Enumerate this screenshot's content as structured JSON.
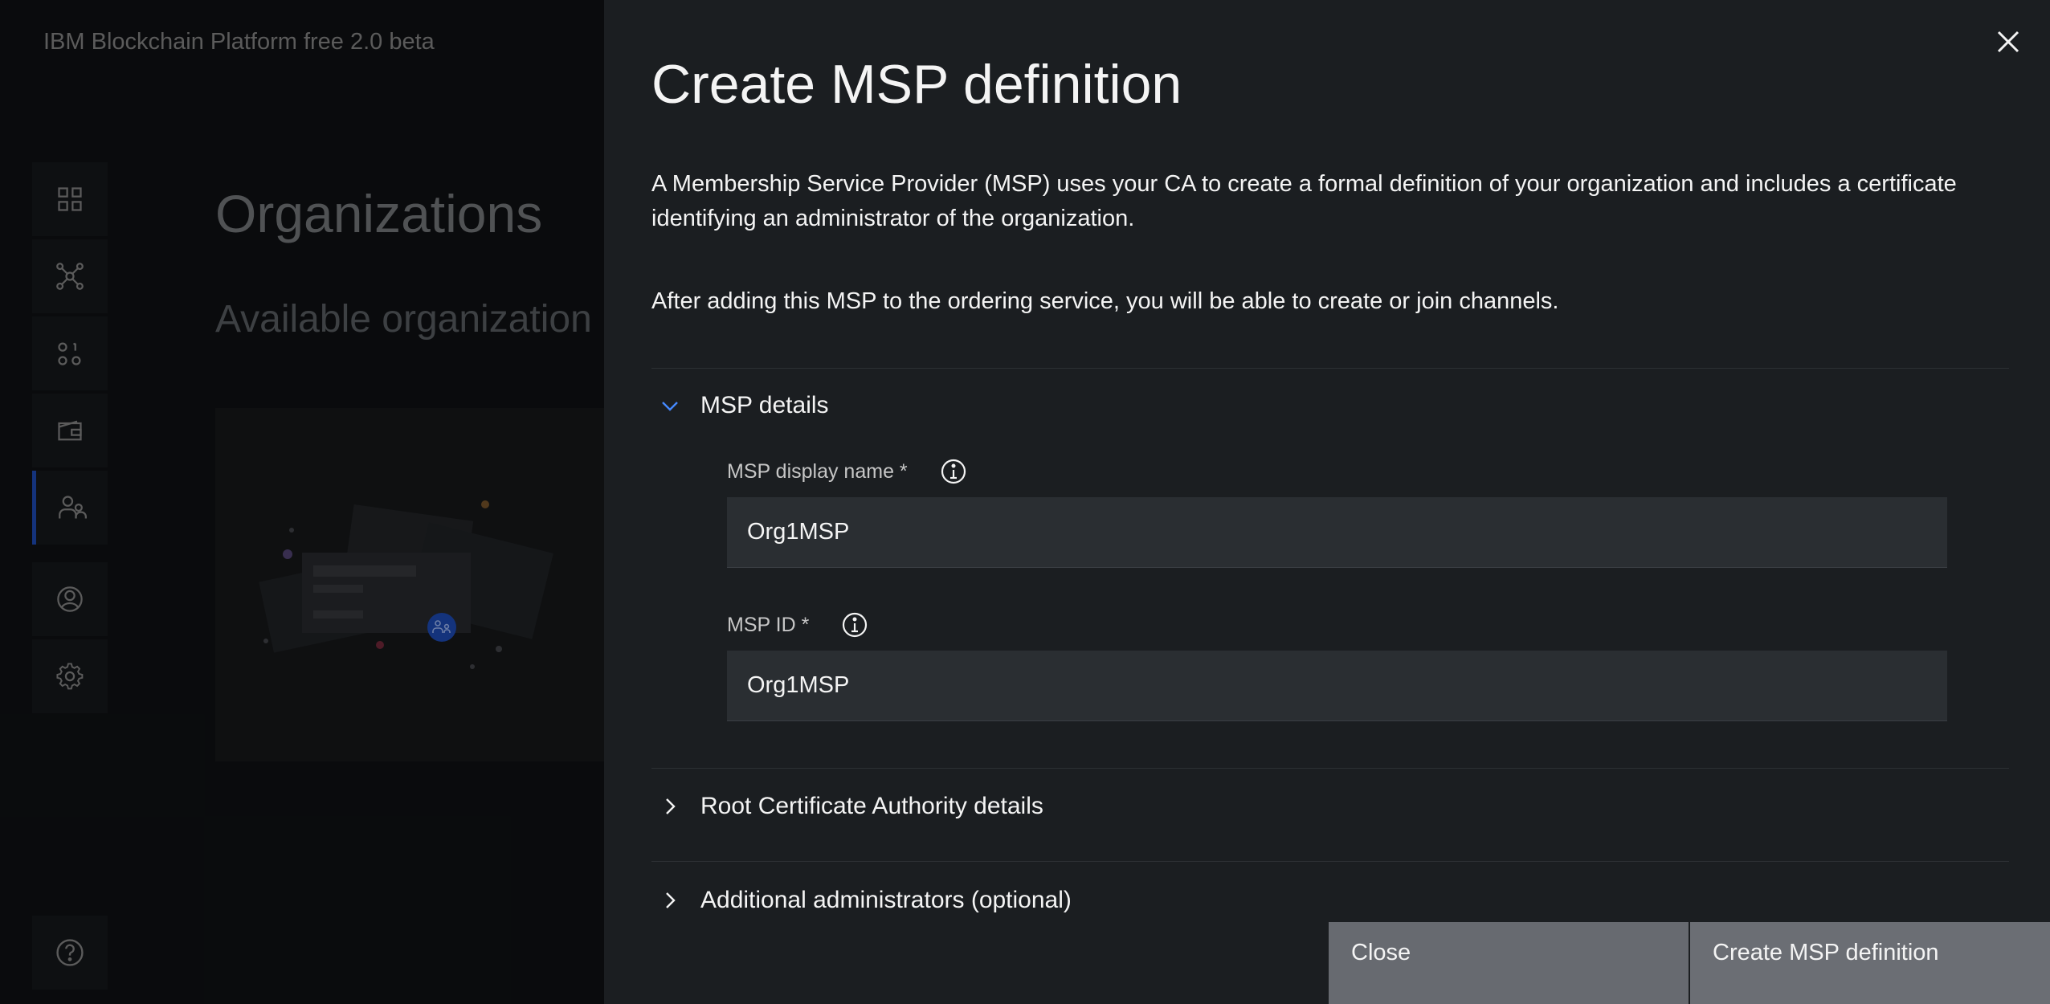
{
  "app": {
    "title": "IBM Blockchain Platform free 2.0 beta"
  },
  "sidebar": {
    "items": [
      {
        "icon": "dashboard-grid-icon"
      },
      {
        "icon": "network-nodes-icon"
      },
      {
        "icon": "binary-identities-icon"
      },
      {
        "icon": "wallet-icon"
      },
      {
        "icon": "organizations-icon",
        "active": true
      },
      {
        "icon": "user-profile-icon"
      },
      {
        "icon": "settings-gear-icon"
      }
    ],
    "help_icon": "help-icon"
  },
  "background_page": {
    "title": "Organizations",
    "subtitle": "Available organization"
  },
  "panel": {
    "title": "Create MSP definition",
    "description_1": "A Membership Service Provider (MSP) uses your CA to create a formal definition of your organization and includes a certificate identifying an administrator of the organization.",
    "description_2": "After adding this MSP to the ordering service, you will be able to create or join channels.",
    "sections": {
      "msp_details": {
        "label": "MSP details",
        "expanded": true,
        "display_name_label": "MSP display name *",
        "display_name_value": "Org1MSP",
        "msp_id_label": "MSP ID *",
        "msp_id_value": "Org1MSP"
      },
      "root_ca": {
        "label": "Root Certificate Authority details",
        "expanded": false
      },
      "admins": {
        "label": "Additional administrators (optional)",
        "expanded": false
      }
    },
    "buttons": {
      "close": "Close",
      "create": "Create MSP definition"
    }
  },
  "colors": {
    "panel_bg": "#1b1e21",
    "input_bg": "#2a2e32",
    "accent": "#1f4fbf",
    "button_bg": "#676a70"
  }
}
